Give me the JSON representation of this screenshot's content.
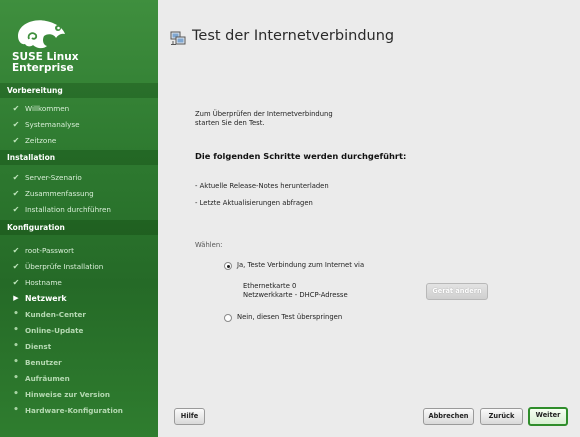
{
  "brand": {
    "line1": "SUSE Linux",
    "line2": "Enterprise"
  },
  "sidebar": {
    "sections": [
      {
        "title": "Vorbereitung",
        "steps": [
          {
            "label": "Willkommen",
            "state": "done"
          },
          {
            "label": "Systemanalyse",
            "state": "done"
          },
          {
            "label": "Zeitzone",
            "state": "done"
          }
        ]
      },
      {
        "title": "Installation",
        "steps": [
          {
            "label": "Server-Szenario",
            "state": "done"
          },
          {
            "label": "Zusammenfassung",
            "state": "done"
          },
          {
            "label": "Installation durchführen",
            "state": "done"
          }
        ]
      },
      {
        "title": "Konfiguration",
        "steps": [
          {
            "label": "root-Passwort",
            "state": "done"
          },
          {
            "label": "Überprüfe Installation",
            "state": "done"
          },
          {
            "label": "Hostname",
            "state": "done"
          },
          {
            "label": "Netzwerk",
            "state": "current"
          },
          {
            "label": "Kunden-Center",
            "state": "todo"
          },
          {
            "label": "Online-Update",
            "state": "todo"
          },
          {
            "label": "Dienst",
            "state": "todo"
          },
          {
            "label": "Benutzer",
            "state": "todo"
          },
          {
            "label": "Aufräumen",
            "state": "todo"
          },
          {
            "label": "Hinweise zur Version",
            "state": "todo"
          },
          {
            "label": "Hardware-Konfiguration",
            "state": "todo"
          }
        ]
      }
    ]
  },
  "dialog": {
    "title": "Test der Internetverbindung",
    "intro_line1": "Zum Überprüfen der Internetverbindung",
    "intro_line2": "starten Sie den Test.",
    "steps_heading": "Die folgenden Schritte werden durchgeführt:",
    "step1": "- Aktuelle Release-Notes herunterladen",
    "step2": "- Letzte Aktualisierungen abfragen",
    "choose_label": "Wählen:",
    "option_yes": "Ja, Teste Verbindung zum Internet via",
    "device_name": "Ethernetkarte 0",
    "device_desc": "Netzwerkkarte - DHCP-Adresse",
    "change_device": "Gerät ändern",
    "option_no": "Nein, diesen Test überspringen",
    "selected_option": "yes"
  },
  "buttons": {
    "help": "Hilfe",
    "abort": "Abbrechen",
    "back": "Zurück",
    "next": "Weiter"
  },
  "colors": {
    "sidebar_green": "#2e7a30",
    "accent": "#2f8d2b"
  }
}
